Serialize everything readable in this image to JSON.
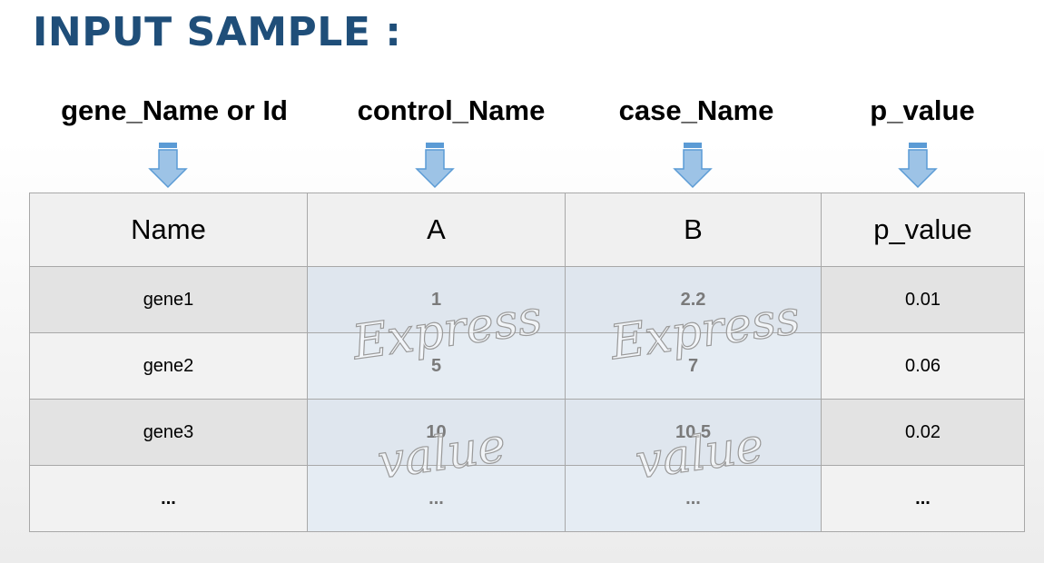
{
  "title": "INPUT SAMPLE :",
  "column_labels": [
    "gene_Name or Id",
    "control_Name",
    "case_Name",
    "p_value"
  ],
  "table": {
    "headers": [
      "Name",
      "A",
      "B",
      "p_value"
    ],
    "rows": [
      [
        "gene1",
        "1",
        "2.2",
        "0.01"
      ],
      [
        "gene2",
        "5",
        "7",
        "0.06"
      ],
      [
        "gene3",
        "10",
        "10.5",
        "0.02"
      ],
      [
        "...",
        "...",
        "...",
        "..."
      ]
    ]
  },
  "watermarks": {
    "a_top": "Express",
    "a_bottom": "value",
    "b_top": "Express",
    "b_bottom": "value"
  },
  "colors": {
    "title": "#1f4e79",
    "arrow_fill": "#9dc3e6",
    "arrow_stroke": "#5b9bd5"
  }
}
